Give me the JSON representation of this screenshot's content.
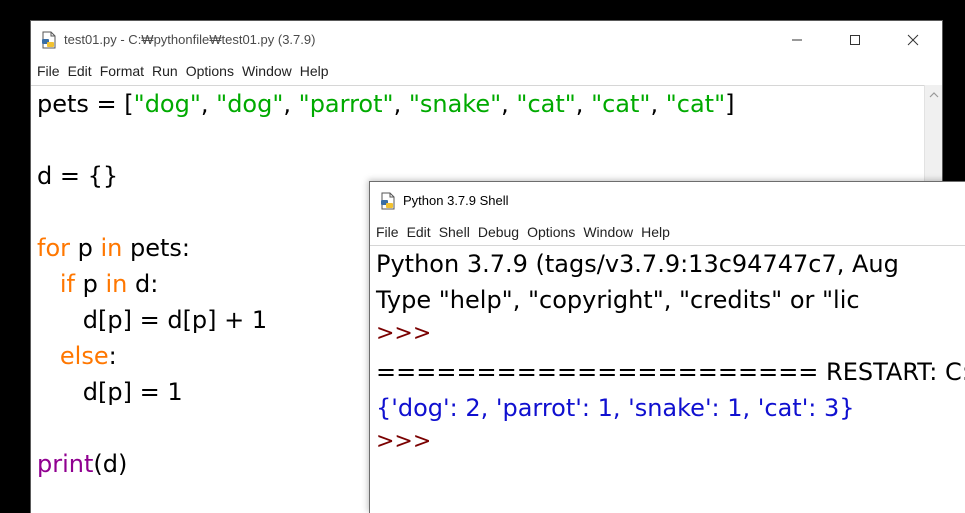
{
  "editor": {
    "title": "test01.py - C:₩pythonfile₩test01.py (3.7.9)",
    "menu": [
      "File",
      "Edit",
      "Format",
      "Run",
      "Options",
      "Window",
      "Help"
    ],
    "code": {
      "line1": {
        "var": "pets = [",
        "s1": "\"dog\"",
        "c1": ", ",
        "s2": "\"dog\"",
        "c2": ", ",
        "s3": "\"parrot\"",
        "c3": ", ",
        "s4": "\"snake\"",
        "c4": ", ",
        "s5": "\"cat\"",
        "c5": ", ",
        "s6": "\"cat\"",
        "c6": ", ",
        "s7": "\"cat\"",
        "end": "]"
      },
      "line2": "d = {}",
      "line3": {
        "kw1": "for",
        "mid1": " p ",
        "kw2": "in",
        "rest": " pets:"
      },
      "line4": {
        "indent": "   ",
        "kw1": "if",
        "mid": " p ",
        "kw2": "in",
        "rest": " d:"
      },
      "line5": "      d[p] = d[p] + 1",
      "line6": {
        "indent": "   ",
        "kw": "else",
        "rest": ":"
      },
      "line7": "      d[p] = 1",
      "line8": {
        "bi": "print",
        "rest": "(d)"
      }
    }
  },
  "shell": {
    "title": "Python 3.7.9 Shell",
    "menu": [
      "File",
      "Edit",
      "Shell",
      "Debug",
      "Options",
      "Window",
      "Help"
    ],
    "lines": {
      "banner": "Python 3.7.9 (tags/v3.7.9:13c94747c7, Aug",
      "help": "Type \"help\", \"copyright\", \"credits\" or \"lic",
      "prompt1": ">>>",
      "restart": "====================== RESTART: C:₩p",
      "output": "{'dog': 2, 'parrot': 1, 'snake': 1, 'cat': 3}",
      "prompt2": ">>>"
    }
  },
  "colors": {
    "keyword": "#ff7700",
    "string": "#00aa00",
    "builtin": "#900090",
    "output": "#1010d0",
    "prompt": "#7a0000"
  },
  "icons": {
    "editor_app": "python-file-icon",
    "shell_app": "python-shell-icon",
    "minimize": "minimize-icon",
    "maximize": "maximize-icon",
    "close": "close-icon",
    "scroll_up": "chevron-up-icon"
  }
}
